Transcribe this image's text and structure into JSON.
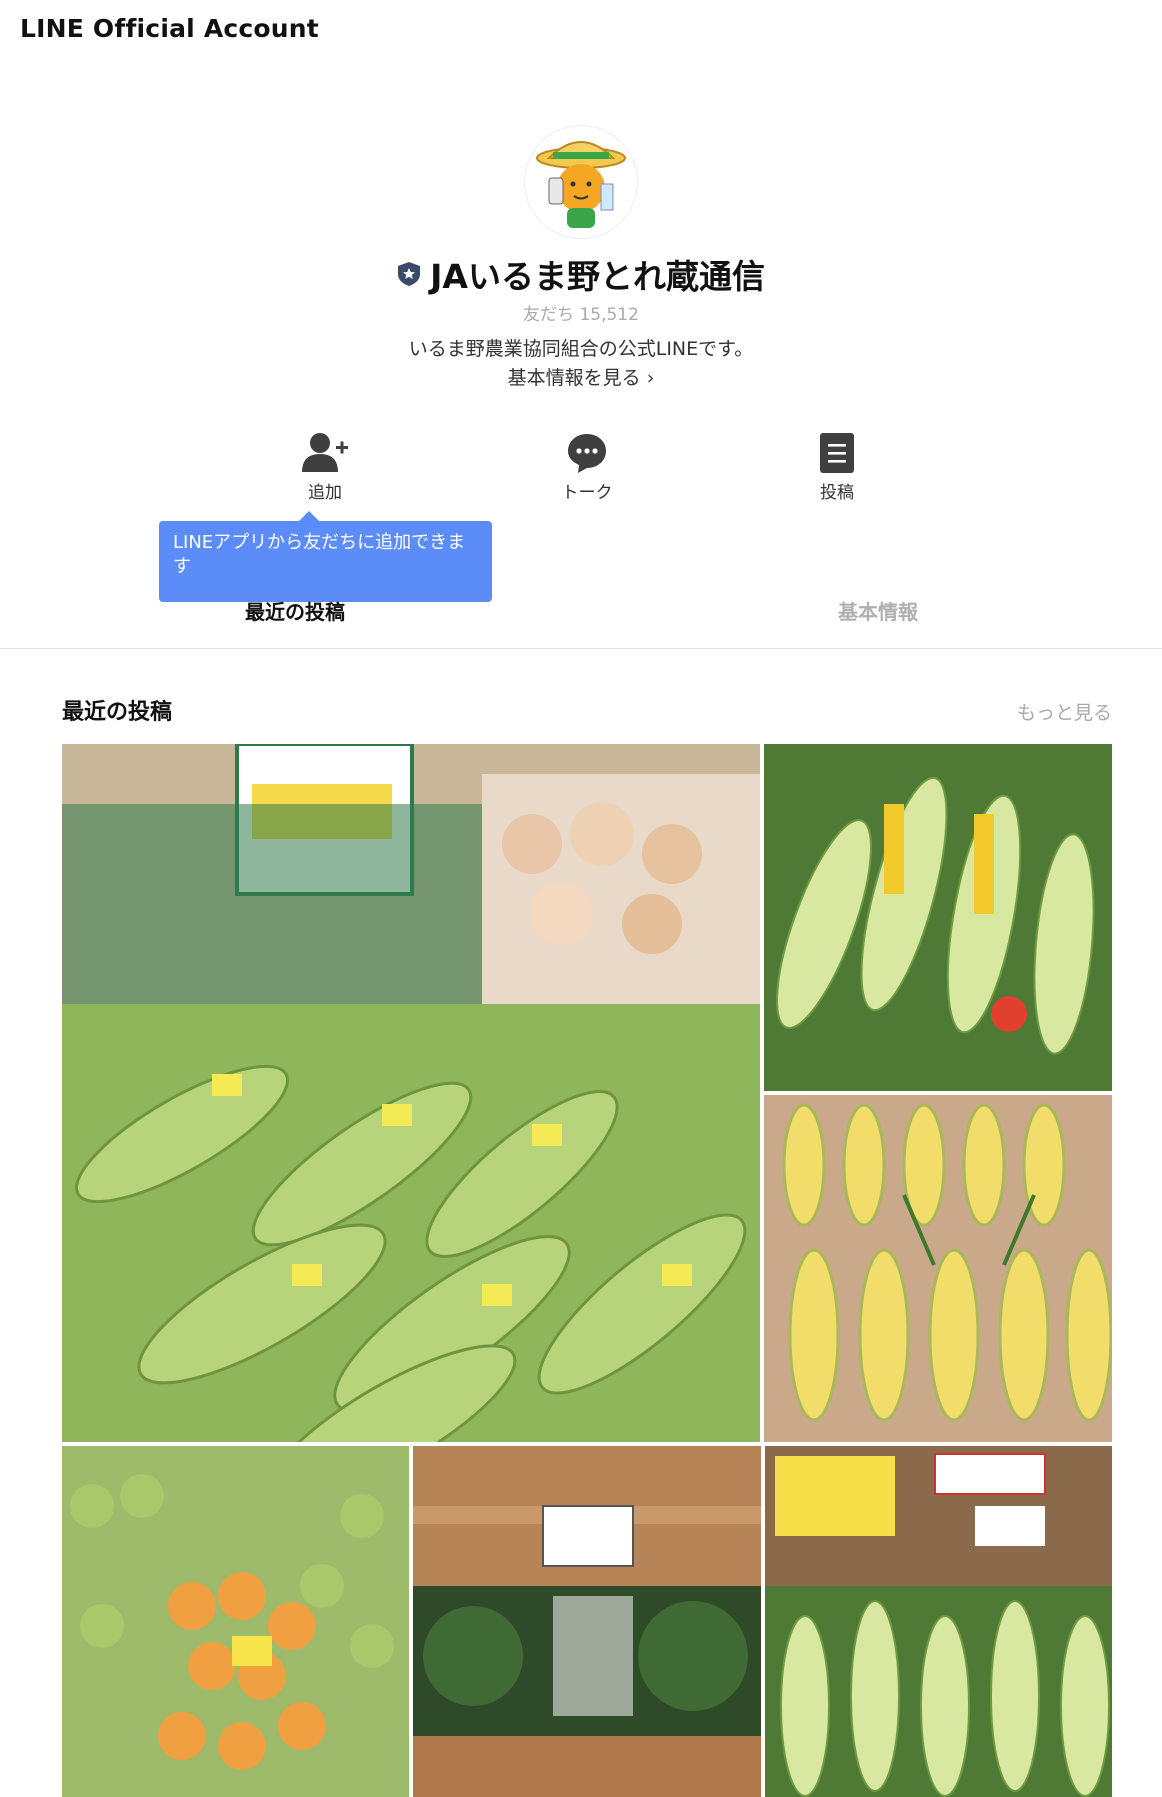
{
  "header": {
    "title": "LINE Official Account"
  },
  "profile": {
    "name": "JAいるま野とれ蔵通信",
    "friends": "友だち 15,512",
    "description": "いるま野農業協同組合の公式LINEです。",
    "more_info": "基本情報を見る ›"
  },
  "actions": [
    {
      "label": "追加",
      "icon": "add-friend-icon"
    },
    {
      "label": "トーク",
      "icon": "chat-bubble-icon"
    },
    {
      "label": "投稿",
      "icon": "post-icon"
    }
  ],
  "tooltip": "LINEアプリから友だちに追加できます",
  "tabs": [
    {
      "label": "最近の投稿",
      "active": true
    },
    {
      "label": "基本情報",
      "active": false
    }
  ],
  "posts": {
    "title": "最近の投稿",
    "see_more": "もっと見る"
  },
  "colors": {
    "accent": "#5b8cf7",
    "tooltip_bg": "#5b8cf7"
  }
}
